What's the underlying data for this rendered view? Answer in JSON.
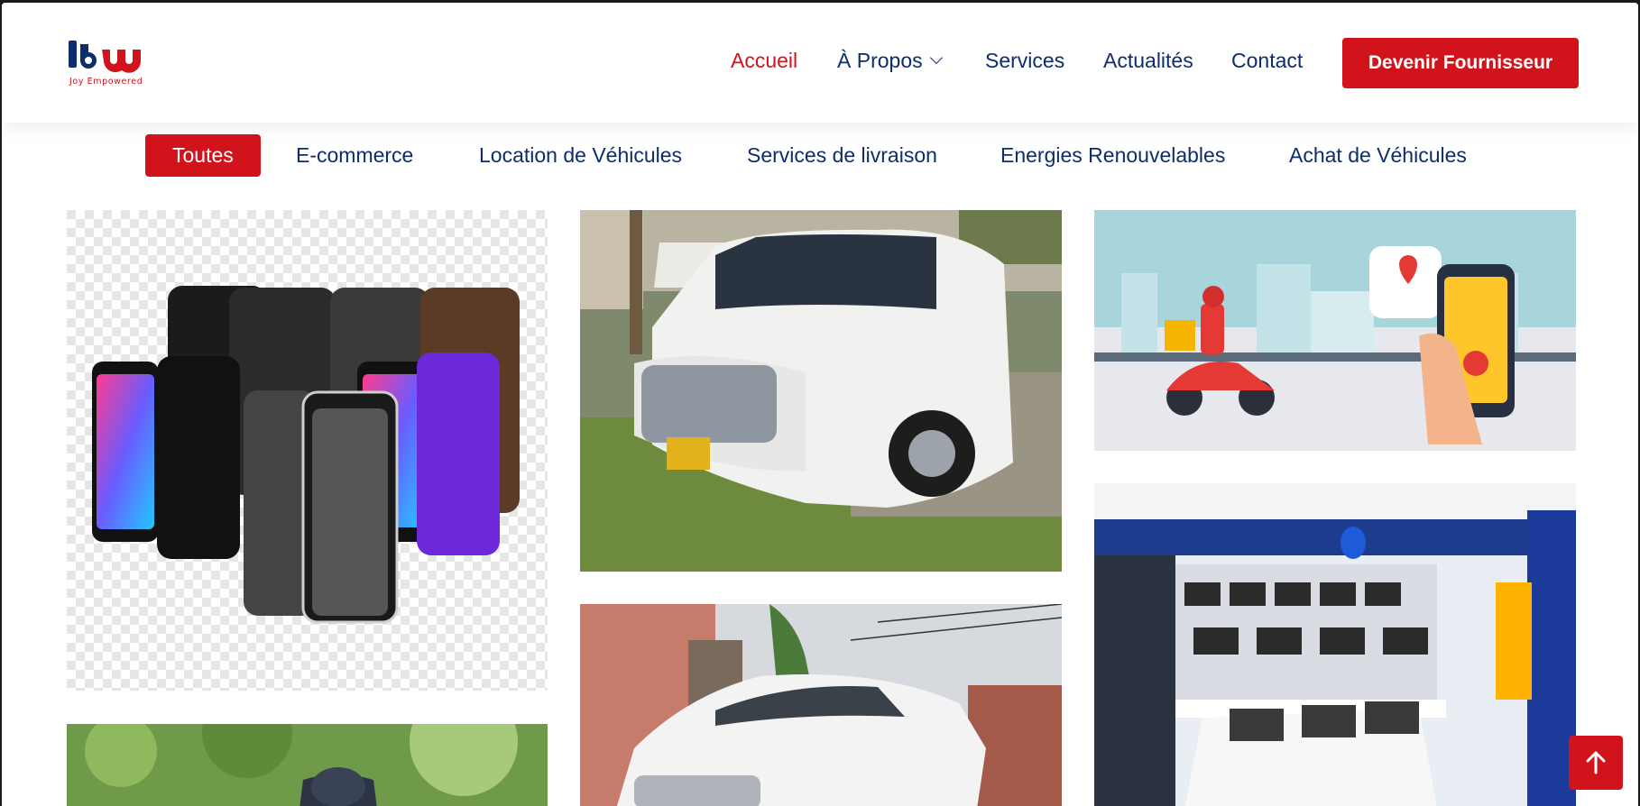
{
  "brand": {
    "logo_text": "lbw",
    "tagline": "Joy Empowered",
    "primary_color": "#d1141c",
    "navy_color": "#0d2d6b"
  },
  "nav": {
    "items": [
      {
        "label": "Accueil",
        "active": true
      },
      {
        "label": "À Propos",
        "dropdown": true
      },
      {
        "label": "Services"
      },
      {
        "label": "Actualités"
      },
      {
        "label": "Contact"
      }
    ],
    "cta_label": "Devenir Fournisseur"
  },
  "filters": [
    {
      "label": "Toutes",
      "active": true
    },
    {
      "label": "E-commerce"
    },
    {
      "label": "Location de Véhicules"
    },
    {
      "label": "Services de livraison"
    },
    {
      "label": "Energies Renouvelables"
    },
    {
      "label": "Achat de Véhicules"
    }
  ],
  "gallery": [
    {
      "subject": "phone-cases-image"
    },
    {
      "subject": "white-suv-image"
    },
    {
      "subject": "delivery-illustration-image"
    },
    {
      "subject": "electronics-store-image"
    },
    {
      "subject": "white-sedan-image"
    },
    {
      "subject": "person-outdoors-image"
    }
  ],
  "icons": {
    "dropdown": "chevron-down-icon",
    "scroll_top": "arrow-up-icon"
  }
}
